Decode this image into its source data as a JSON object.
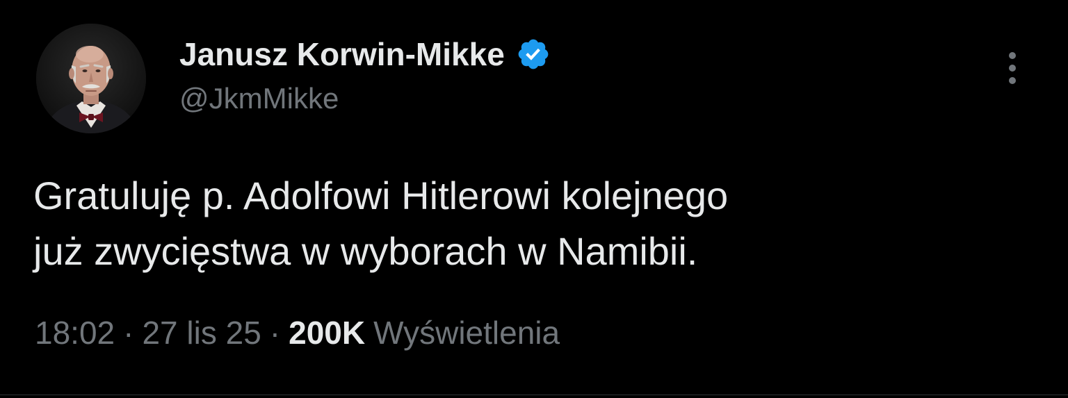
{
  "author": {
    "display_name": "Janusz Korwin-Mikke",
    "handle": "@JkmMikke",
    "verified": true,
    "verified_icon": "verified-badge-icon",
    "avatar_icon": "avatar"
  },
  "tweet": {
    "lines": [
      "Gratuluję p. Adolfowi Hitlerowi kolejnego",
      "już zwycięstwa w wyborach w Namibii."
    ]
  },
  "meta": {
    "time": "18:02",
    "separator": "·",
    "date": "27 lis 25",
    "views_count": "200K",
    "views_label": "Wyświetlenia"
  },
  "actions": {
    "more_icon": "more-vertical-icon"
  },
  "colors": {
    "background": "#000000",
    "primary_text": "#e7e9ea",
    "secondary_text": "#71767b",
    "verified_blue": "#1d9bf0",
    "divider": "#2f3336"
  }
}
